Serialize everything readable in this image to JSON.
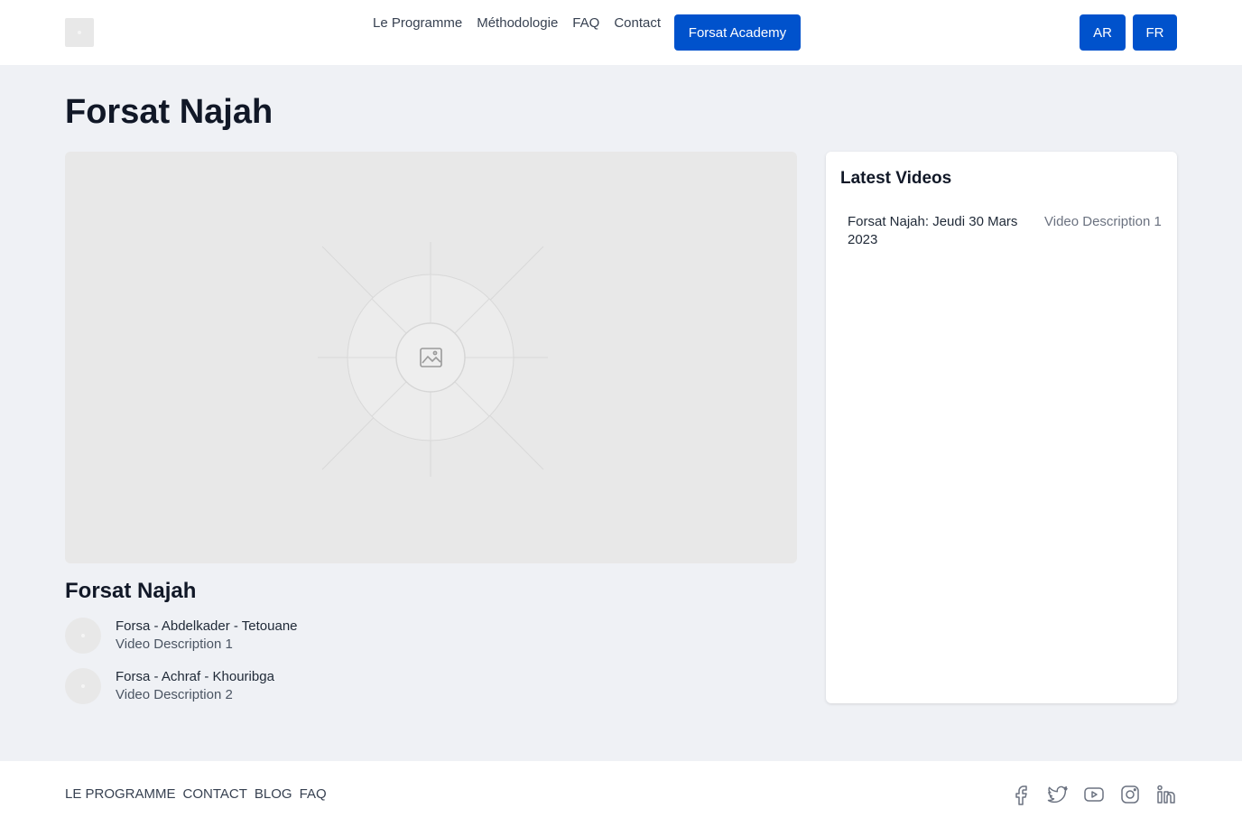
{
  "header": {
    "nav": [
      "Le Programme",
      "Méthodologie",
      "FAQ",
      "Contact"
    ],
    "cta_label": "Forsat Academy",
    "lang_ar": "AR",
    "lang_fr": "FR"
  },
  "main": {
    "title": "Forsat Najah",
    "video_title": "Forsat Najah",
    "playlist": [
      {
        "title": "Forsa - Abdelkader - Tetouane",
        "description": "Video Description 1"
      },
      {
        "title": "Forsa - Achraf - Khouribga",
        "description": "Video Description 2"
      }
    ]
  },
  "sidebar": {
    "heading": "Latest Videos",
    "videos": [
      {
        "title": "Forsat Najah: Jeudi 30 Mars 2023",
        "description": "Video Description 1"
      }
    ]
  },
  "footer": {
    "links": [
      "Le Programme",
      "Contact",
      "Blog",
      "FAQ"
    ],
    "social_icons": [
      "facebook-icon",
      "twitter-icon",
      "youtube-icon",
      "instagram-icon",
      "linkedin-icon"
    ]
  },
  "colors": {
    "accent": "#0052cc",
    "background": "#eff1f5",
    "placeholder": "#e8e8e8"
  }
}
